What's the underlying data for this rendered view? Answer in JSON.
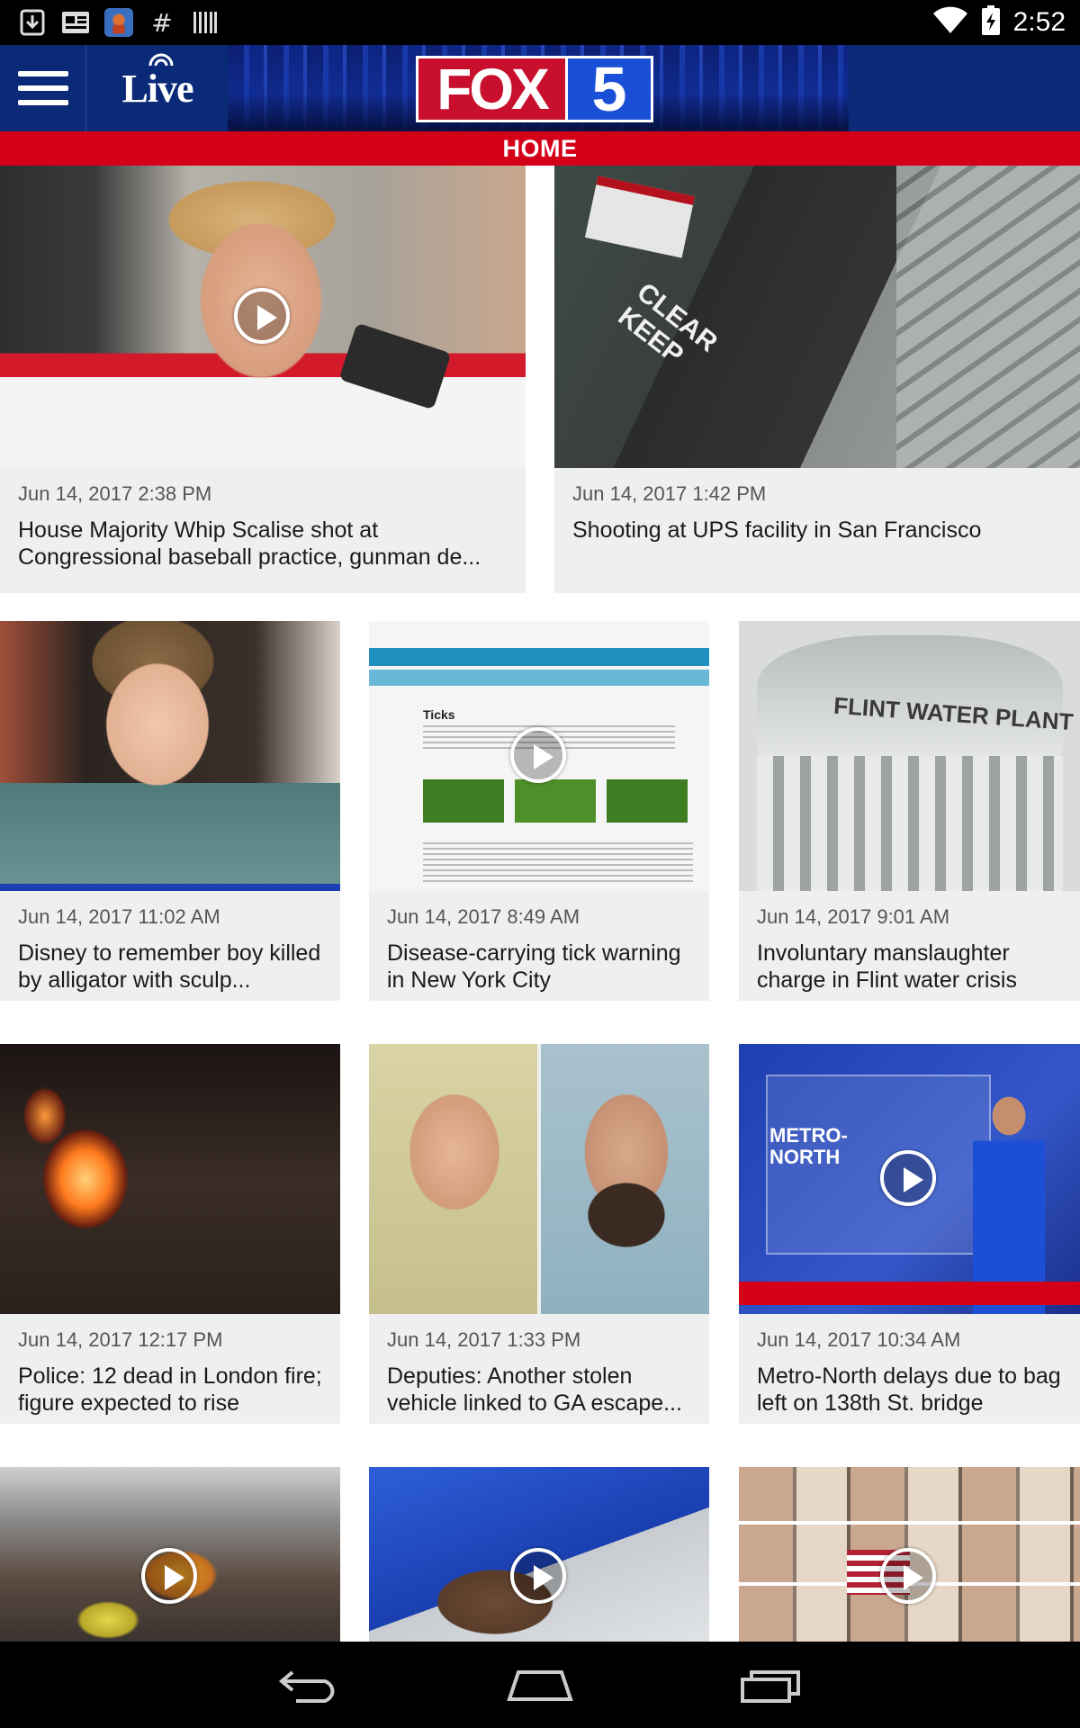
{
  "status_bar": {
    "left_icons": [
      "download-icon",
      "news-icon",
      "app-icon",
      "hashtag-icon",
      "barcode-icon"
    ],
    "time": "2:52",
    "right_icons": [
      "wifi-icon",
      "battery-charging-icon"
    ]
  },
  "header": {
    "menu_icon": "hamburger-menu-icon",
    "live_label": "Live",
    "logo_text": "FOX",
    "logo_number": "5",
    "section_title": "HOME"
  },
  "colors": {
    "header_blue": "#0a2a78",
    "section_red": "#d4001a",
    "logo_red": "#c8102e",
    "logo_blue": "#1a4fd8",
    "card_bg": "#efefef"
  },
  "feed": [
    {
      "date": "Jun 14, 2017 2:38 PM",
      "title": "House Majority Whip Scalise shot at Congressional baseball practice, gunman de...",
      "has_video": true
    },
    {
      "date": "Jun 14, 2017 1:42 PM",
      "title": "Shooting at UPS facility in San Francisco",
      "has_video": false,
      "image_text": "CLEAR KEEP"
    },
    {
      "date": "Jun 14, 2017 11:02 AM",
      "title": "Disney to remember boy killed by alligator with sculp...",
      "has_video": false
    },
    {
      "date": "Jun 14, 2017 8:49 AM",
      "title": "Disease-carrying tick warning in New York City",
      "has_video": true,
      "image_text": "Ticks"
    },
    {
      "date": "Jun 14, 2017 9:01 AM",
      "title": "Involuntary manslaughter charge in Flint water crisis",
      "has_video": false,
      "image_text": "FLINT WATER PLANT"
    },
    {
      "date": "Jun 14, 2017 12:17 PM",
      "title": "Police: 12 dead in London fire; figure expected to rise",
      "has_video": false
    },
    {
      "date": "Jun 14, 2017 1:33 PM",
      "title": "Deputies: Another stolen vehicle linked to GA escape...",
      "has_video": false
    },
    {
      "date": "Jun 14, 2017 10:34 AM",
      "title": "Metro-North delays due to bag left on 138th St. bridge",
      "has_video": true,
      "image_text": "METRO-NORTH"
    },
    {
      "has_video": true
    },
    {
      "has_video": true
    },
    {
      "has_video": true
    }
  ],
  "nav_bar": {
    "back_icon": "back-icon",
    "home_icon": "home-icon",
    "recents_icon": "recents-icon"
  }
}
